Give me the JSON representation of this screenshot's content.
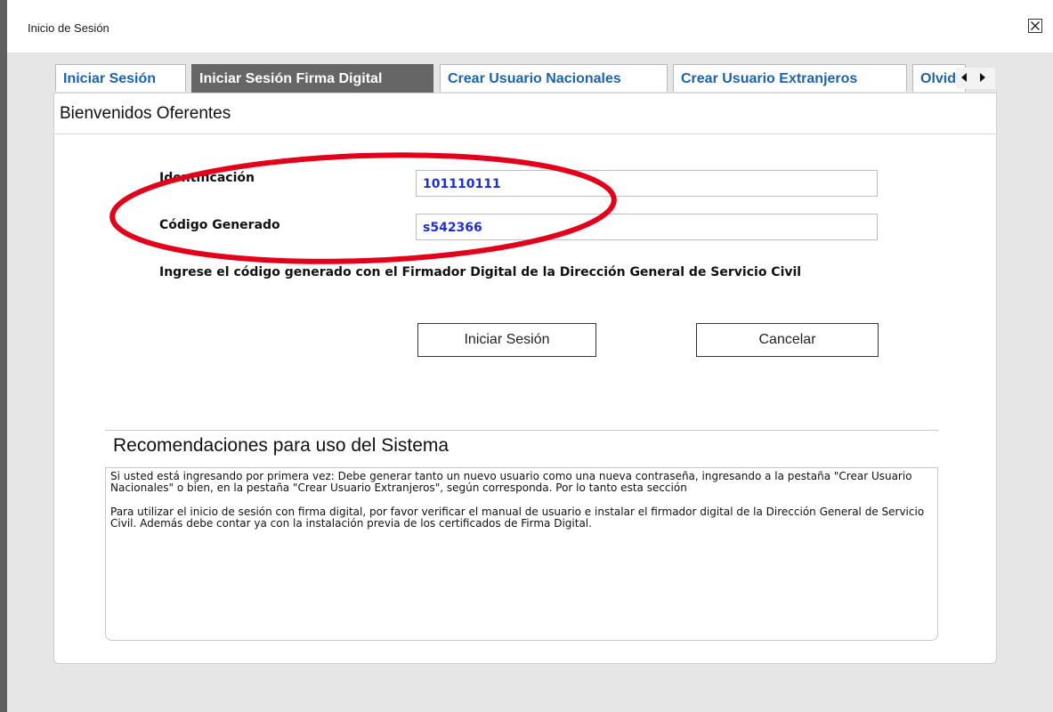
{
  "dialog": {
    "title": "Inicio de Sesión",
    "close_icon": "close-icon"
  },
  "tabs": [
    {
      "label": "Iniciar Sesión",
      "active": false
    },
    {
      "label": "Iniciar Sesión Firma Digital",
      "active": true
    },
    {
      "label": "Crear Usuario Nacionales",
      "active": false
    },
    {
      "label": "Crear Usuario Extranjeros",
      "active": false
    },
    {
      "label": "Olvid",
      "active": false
    }
  ],
  "tab_scroll": {
    "left_icon": "arrow-left-icon",
    "right_icon": "arrow-right-icon"
  },
  "panel": {
    "title": "Bienvenidos Oferentes"
  },
  "form": {
    "identificacion_label": "Identificación",
    "identificacion_value": "101110111",
    "codigo_label": "Código Generado",
    "codigo_value": "s542366",
    "instruction": "Ingrese el código generado con el Firmador Digital de la Dirección General de Servicio Civil",
    "login_button": "Iniciar Sesión",
    "cancel_button": "Cancelar"
  },
  "recommendations": {
    "title": "Recomendaciones para uso del Sistema",
    "paragraph1": "Si usted está ingresando por primera vez: Debe generar tanto un nuevo usuario como una nueva contraseña, ingresando a la pestaña \"Crear Usuario Nacionales\" o bien, en la pestaña \"Crear Usuario Extranjeros\", según corresponda. Por lo tanto esta sección",
    "paragraph2": "Para utilizar el inicio de sesión con firma digital, por favor verificar el manual de usuario e instalar el firmador digital de la Dirección General de Servicio Civil. Además debe contar ya con la instalación previa de los certificados de Firma Digital."
  },
  "colors": {
    "active_tab": "#666666",
    "tab_text": "#1e63a8",
    "input_text": "#1f2fd6",
    "annotation": "#e3001b"
  }
}
